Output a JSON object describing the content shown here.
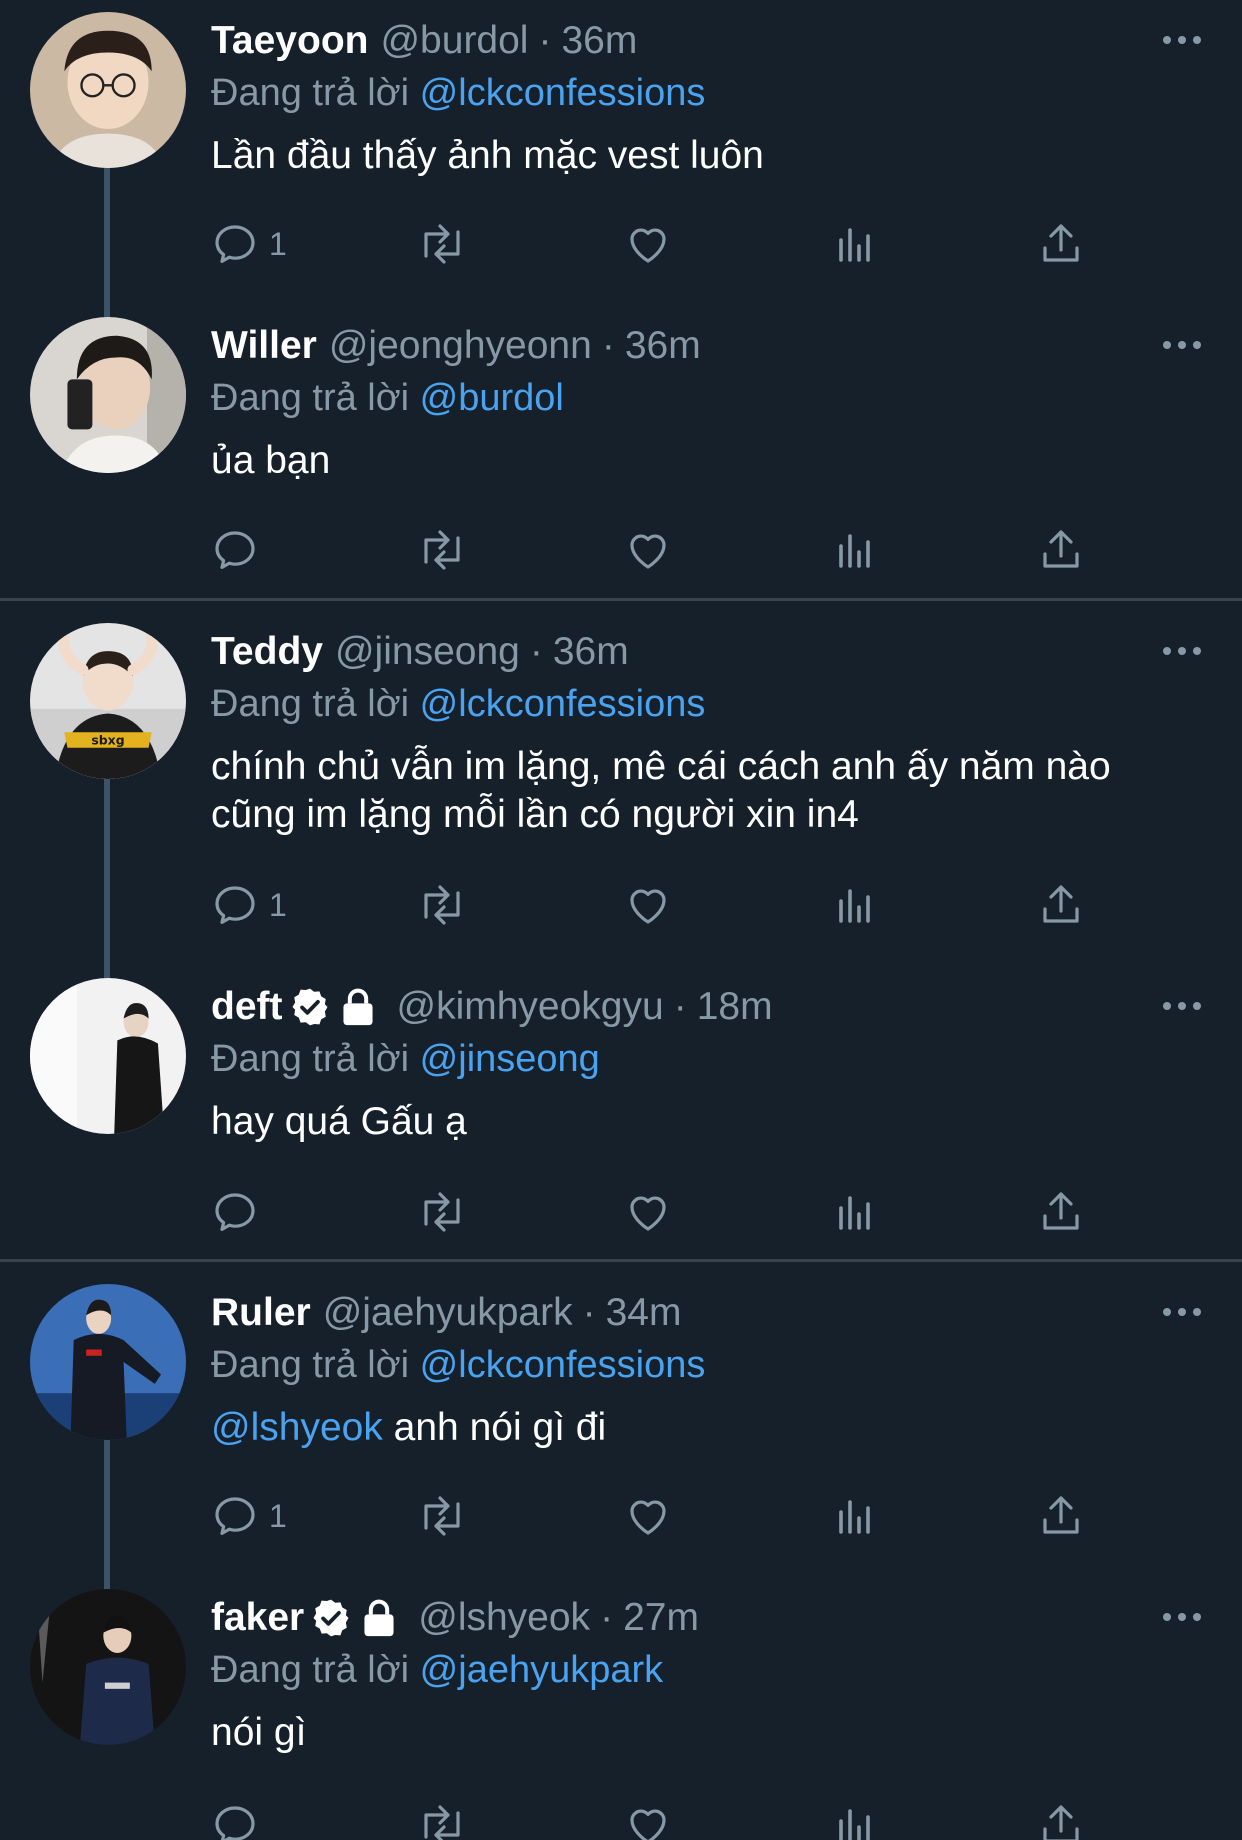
{
  "colors": {
    "background": "#15202b",
    "secondary_text": "#8899a6",
    "mention": "#4aa3f0",
    "divider": "#38444d",
    "thread_line": "#3d5466"
  },
  "tweets": [
    {
      "name": "Taeyoon",
      "handle": "@burdol",
      "separator": "·",
      "time": "36m",
      "replying_prefix": "Đang trả lời",
      "replying_to": "@lckconfessions",
      "body": "Lần đầu thấy ảnh mặc vest luôn",
      "reply_count": "1"
    },
    {
      "name": "Willer",
      "handle": "@jeonghyeonn",
      "separator": "·",
      "time": "36m",
      "replying_prefix": "Đang trả lời",
      "replying_to": "@burdol",
      "body": "ủa bạn",
      "reply_count": ""
    },
    {
      "name": "Teddy",
      "handle": "@jinseong",
      "separator": "·",
      "time": "36m",
      "replying_prefix": "Đang trả lời",
      "replying_to": "@lckconfessions",
      "body_line1": "chính chủ vẫn im lặng, mê cái cách anh ấy năm nào",
      "body_line2": "cũng im lặng mỗi lần có người xin in4",
      "reply_count": "1"
    },
    {
      "name": "deft",
      "handle": "@kimhyeokgyu",
      "separator": "·",
      "time": "18m",
      "replying_prefix": "Đang trả lời",
      "replying_to": "@jinseong",
      "body": "hay quá Gấu ạ",
      "reply_count": "",
      "verified": true,
      "protected": true
    },
    {
      "name": "Ruler",
      "handle": "@jaehyukpark",
      "separator": "·",
      "time": "34m",
      "replying_prefix": "Đang trả lời",
      "replying_to": "@lckconfessions",
      "body_mention": "@lshyeok",
      "body": " anh nói gì đi",
      "reply_count": "1"
    },
    {
      "name": "faker",
      "handle": "@lshyeok",
      "separator": "·",
      "time": "27m",
      "replying_prefix": "Đang trả lời",
      "replying_to": "@jaehyukpark",
      "body": "nói gì",
      "reply_count": "",
      "verified": true,
      "protected": true
    }
  ],
  "icons": {
    "reply": "reply-icon",
    "retweet": "retweet-icon",
    "like": "heart-icon",
    "views": "analytics-icon",
    "share": "share-icon",
    "more": "more-icon",
    "verified": "verified-badge-icon",
    "protected": "lock-icon"
  }
}
